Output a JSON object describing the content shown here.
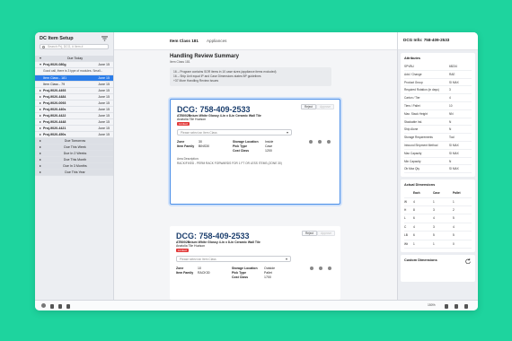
{
  "sidebar": {
    "title": "DC Item Setup",
    "search_placeholder": "Search Prj, DCG, # Item #",
    "rows": [
      {
        "label": "Due Today",
        "right": "",
        "kind": "gray"
      },
      {
        "label": "Proj-9020-080g",
        "right": "June 15",
        "kind": "proj-open"
      },
      {
        "label": "Item Class - 181",
        "right": "June 15",
        "kind": "sel"
      },
      {
        "label": "Item Class - 79",
        "right": "June 15",
        "kind": "sub"
      },
      {
        "label": "Proj-9020-4493",
        "right": "June 15",
        "kind": "proj"
      },
      {
        "label": "Proj-9020-4484",
        "right": "June 15",
        "kind": "proj"
      },
      {
        "label": "Proj-9020-0093",
        "right": "June 15",
        "kind": "proj"
      },
      {
        "label": "Proj-9020-440s",
        "right": "June 15",
        "kind": "proj"
      },
      {
        "label": "Proj-9020-4422",
        "right": "June 15",
        "kind": "proj"
      },
      {
        "label": "Proj-9020-4448",
        "right": "June 15",
        "kind": "proj"
      },
      {
        "label": "Proj-9020-4421",
        "right": "June 15",
        "kind": "proj"
      },
      {
        "label": "Proj-9020-450s",
        "right": "June 15",
        "kind": "proj"
      },
      {
        "label": "Due Tomorrow",
        "right": "",
        "kind": "gray"
      },
      {
        "label": "Due This Week",
        "right": "",
        "kind": "gray"
      },
      {
        "label": "Due In 2 Weeks",
        "right": "",
        "kind": "gray"
      },
      {
        "label": "Due This Month",
        "right": "",
        "kind": "gray"
      },
      {
        "label": "Due In 3 Months",
        "right": "",
        "kind": "gray"
      },
      {
        "label": "Due This Year",
        "right": "",
        "kind": "gray"
      }
    ],
    "note": "Good call, there is 3 type of modules. Small..."
  },
  "tabs": [
    {
      "label": "Item Class 181"
    },
    {
      "label": "Appliances"
    }
  ],
  "summary": {
    "title": "Handling Review Summary",
    "subtitle": "Item Class 181",
    "lines": [
      "16 – Program contains SOR items in 10 case sizes (appliance items excluded)",
      "16 – Ship Unit equal IP and Case Dimensions states BP guidelines",
      "+37 More Handling Review Issues"
    ]
  },
  "cards": [
    {
      "dcg": "DCG: 758-409-2533",
      "desc": "ATB002Bnium White Glossy 4-in x 8-in Ceramic Wall Tile",
      "loc": "Anatolia Tile Hudson",
      "tag": "Limited",
      "reject": "Reject",
      "approve": "Approve",
      "select_placeholder": "Please select an Item Class",
      "fields": [
        [
          "Zone",
          "30",
          "Storage Location",
          "Inside"
        ],
        [
          "Item Family",
          "BINS30",
          "Pick Type",
          "Case"
        ],
        [
          "",
          "",
          "Cost Class",
          "1200"
        ]
      ],
      "area_label": "Area Description:",
      "area_text": "RACK/FIXED - PERM RACK FORWARDS FOR 1 FT OR LESS ITEMS (ZONE 30)"
    },
    {
      "dcg": "DCG: 758-409-2533",
      "desc": "ATB002Bnium White Glossy 4-in x 8-in Ceramic Wall Tile",
      "loc": "Anatolia Tile Hudson",
      "tag": "Limited",
      "reject": "Reject",
      "approve": "Approve",
      "select_placeholder": "Please select an Item Class",
      "fields": [
        [
          "Zone",
          "10",
          "Storage Location",
          "Outside"
        ],
        [
          "Item Family",
          "RACK30",
          "Pick Type",
          "Pallet"
        ],
        [
          "",
          "",
          "Cost Class",
          "1700"
        ]
      ]
    }
  ],
  "right_panel": {
    "title": "DCG Info: 758-409-2533",
    "attributes_title": "Attributes",
    "attributes": [
      [
        "SPVBU",
        "68234"
      ],
      [
        "Add / Change",
        "RAE"
      ],
      [
        "Product Group",
        "SI MAX"
      ],
      [
        "Required Rotation (in days)",
        "3"
      ],
      [
        "Carton / Tier",
        "4"
      ],
      [
        "Tiers / Pallet",
        "10"
      ],
      [
        "Max. Stack Height",
        "NN"
      ],
      [
        "Stackable Ind.",
        "N"
      ],
      [
        "Ship Alone",
        "N"
      ],
      [
        "Storage Requirements",
        "Tool"
      ],
      [
        "Inbound Shipment Method",
        "SI MAX"
      ],
      [
        "Max Capacity",
        "SI MAX"
      ],
      [
        "Min Capacity",
        "N"
      ],
      [
        "Ob Max Qty",
        "SI MAX"
      ]
    ],
    "dims_title": "Actual Dimensions",
    "dims_head": [
      "",
      "Each",
      "Case",
      "Pallet"
    ],
    "dims_rows": [
      [
        "W",
        "4",
        "1",
        "1"
      ],
      [
        "H",
        "8",
        "3",
        "2"
      ],
      [
        "L",
        "6",
        "4",
        "5"
      ],
      [
        "C",
        "4",
        "3",
        "4"
      ],
      [
        "LB",
        "6",
        "5",
        "5"
      ],
      [
        "Wt",
        "1",
        "1",
        "0"
      ]
    ],
    "custom_title": "Custom Dimensions"
  },
  "bottom": {
    "zoom": "150%"
  }
}
